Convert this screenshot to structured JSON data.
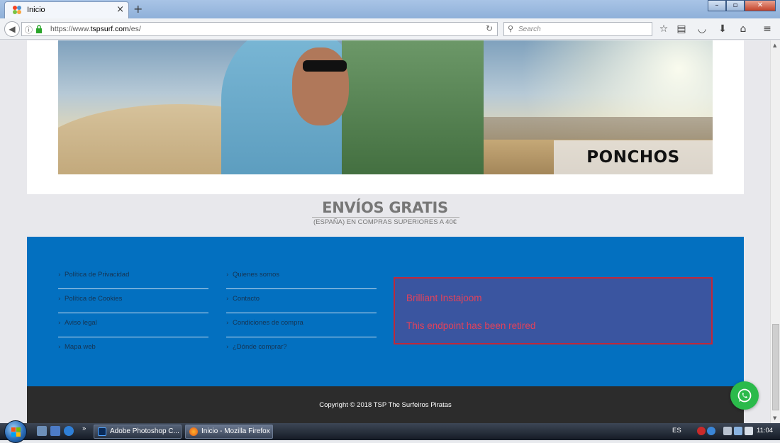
{
  "browser": {
    "tab_title": "Inicio",
    "new_tab_symbol": "+",
    "close_tab_symbol": "×",
    "url_prefix": "https://www.",
    "url_domain": "tspsurf.com",
    "url_path": "/es/",
    "search_placeholder": "Search"
  },
  "banner": {
    "label": "PONCHOS"
  },
  "shipping": {
    "title": "ENVÍOS GRATIS",
    "subtitle": "(ESPAÑA) EN COMPRAS SUPERIORES A 40€"
  },
  "footer": {
    "links_col1": [
      {
        "label": "Política de Privacidad"
      },
      {
        "label": "Política de Cookies"
      },
      {
        "label": "Aviso legal"
      },
      {
        "label": "Mapa web"
      }
    ],
    "links_col2": [
      {
        "label": "Quienes somos"
      },
      {
        "label": "Contacto"
      },
      {
        "label": "Condiciones de compra"
      },
      {
        "label": "¿Dónde comprar?"
      }
    ],
    "insta": {
      "title": "Brilliant Instajoom",
      "message": "This endpoint has been retired"
    },
    "copyright": "Copyright © 2018 TSP The Surfeiros Piratas"
  },
  "taskbar": {
    "tasks": [
      {
        "label": "Adobe Photoshop C..."
      },
      {
        "label": "Inicio - Mozilla Firefox"
      }
    ],
    "language": "ES",
    "clock": "11:04",
    "overflow": "»"
  },
  "colors": {
    "footer_blue": "#0370c0",
    "footer_dark": "#2c2c2c",
    "insta_border": "#c0283a",
    "insta_text": "#e3425a",
    "whatsapp": "#2bba4b"
  },
  "icons": [
    "joomla-favicon-icon",
    "back-arrow-icon",
    "info-icon",
    "lock-icon",
    "reload-icon",
    "search-icon",
    "bookmark-star-icon",
    "reading-list-icon",
    "pocket-icon",
    "download-icon",
    "home-icon",
    "hamburger-menu-icon",
    "whatsapp-icon",
    "windows-start-icon"
  ]
}
